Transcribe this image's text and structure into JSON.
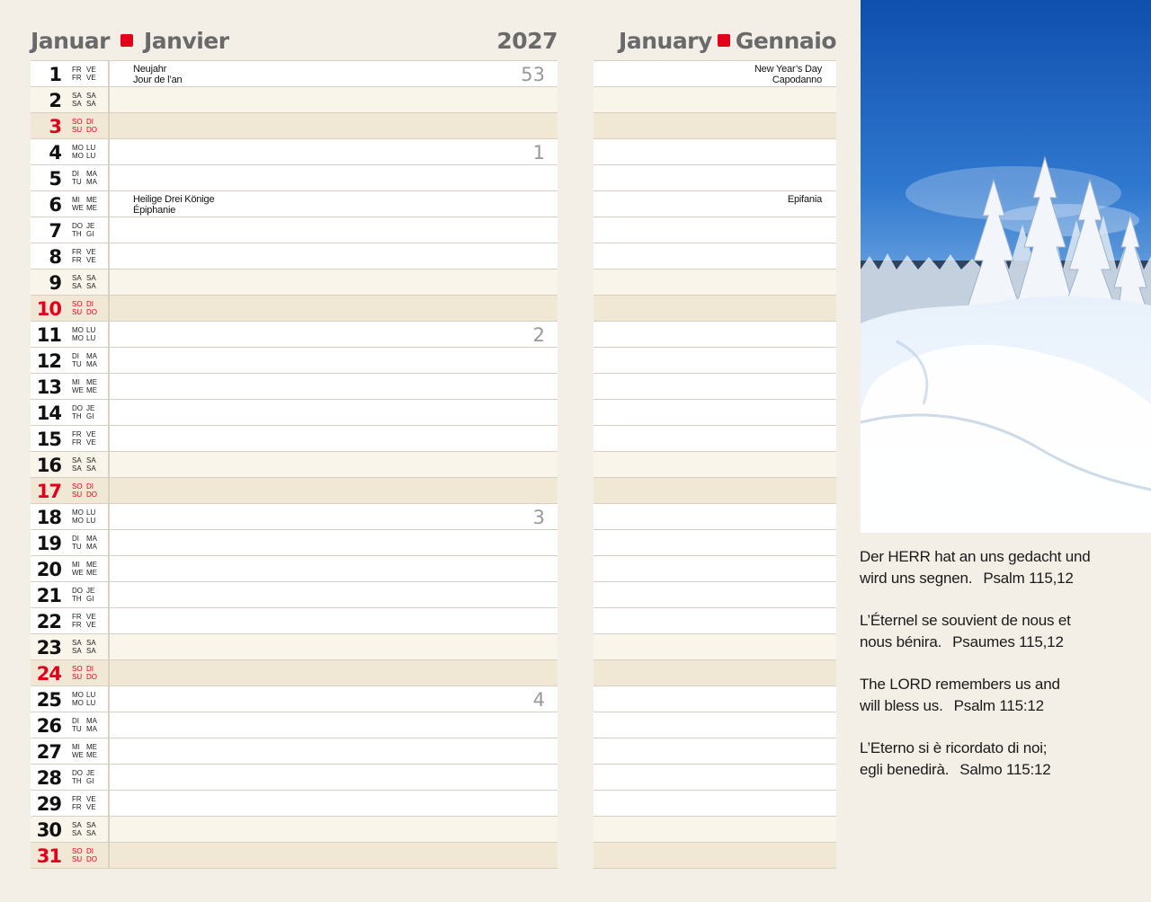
{
  "header": {
    "left_month_de": "Januar",
    "left_month_fr": "Janvier",
    "year": "2027",
    "right_month_en": "January",
    "right_month_it": "Gennaio",
    "accent_color": "#e3001b"
  },
  "days": [
    {
      "day": "1",
      "a1": "FR",
      "a2": "VE",
      "a3": "FR",
      "a4": "VE",
      "type": "weekday",
      "week": "53",
      "note_l1": "Neujahr",
      "note_l2": "Jour de l’an",
      "rnote_l1": "New Year’s Day",
      "rnote_l2": "Capodanno"
    },
    {
      "day": "2",
      "a1": "SA",
      "a2": "SA",
      "a3": "SA",
      "a4": "SA",
      "type": "sat"
    },
    {
      "day": "3",
      "a1": "SO",
      "a2": "DI",
      "a3": "SU",
      "a4": "DO",
      "type": "sun"
    },
    {
      "day": "4",
      "a1": "MO",
      "a2": "LU",
      "a3": "MO",
      "a4": "LU",
      "type": "weekday",
      "week": "1"
    },
    {
      "day": "5",
      "a1": "DI",
      "a2": "MA",
      "a3": "TU",
      "a4": "MA",
      "type": "weekday"
    },
    {
      "day": "6",
      "a1": "MI",
      "a2": "ME",
      "a3": "WE",
      "a4": "ME",
      "type": "weekday",
      "note_l1": "Heilige Drei Könige",
      "note_l2": "Épiphanie",
      "rnote_l1": "",
      "rnote_l2": "Epifania"
    },
    {
      "day": "7",
      "a1": "DO",
      "a2": "JE",
      "a3": "TH",
      "a4": "GI",
      "type": "weekday"
    },
    {
      "day": "8",
      "a1": "FR",
      "a2": "VE",
      "a3": "FR",
      "a4": "VE",
      "type": "weekday"
    },
    {
      "day": "9",
      "a1": "SA",
      "a2": "SA",
      "a3": "SA",
      "a4": "SA",
      "type": "sat"
    },
    {
      "day": "10",
      "a1": "SO",
      "a2": "DI",
      "a3": "SU",
      "a4": "DO",
      "type": "sun"
    },
    {
      "day": "11",
      "a1": "MO",
      "a2": "LU",
      "a3": "MO",
      "a4": "LU",
      "type": "weekday",
      "week": "2"
    },
    {
      "day": "12",
      "a1": "DI",
      "a2": "MA",
      "a3": "TU",
      "a4": "MA",
      "type": "weekday"
    },
    {
      "day": "13",
      "a1": "MI",
      "a2": "ME",
      "a3": "WE",
      "a4": "ME",
      "type": "weekday"
    },
    {
      "day": "14",
      "a1": "DO",
      "a2": "JE",
      "a3": "TH",
      "a4": "GI",
      "type": "weekday"
    },
    {
      "day": "15",
      "a1": "FR",
      "a2": "VE",
      "a3": "FR",
      "a4": "VE",
      "type": "weekday"
    },
    {
      "day": "16",
      "a1": "SA",
      "a2": "SA",
      "a3": "SA",
      "a4": "SA",
      "type": "sat"
    },
    {
      "day": "17",
      "a1": "SO",
      "a2": "DI",
      "a3": "SU",
      "a4": "DO",
      "type": "sun"
    },
    {
      "day": "18",
      "a1": "MO",
      "a2": "LU",
      "a3": "MO",
      "a4": "LU",
      "type": "weekday",
      "week": "3"
    },
    {
      "day": "19",
      "a1": "DI",
      "a2": "MA",
      "a3": "TU",
      "a4": "MA",
      "type": "weekday"
    },
    {
      "day": "20",
      "a1": "MI",
      "a2": "ME",
      "a3": "WE",
      "a4": "ME",
      "type": "weekday"
    },
    {
      "day": "21",
      "a1": "DO",
      "a2": "JE",
      "a3": "TH",
      "a4": "GI",
      "type": "weekday"
    },
    {
      "day": "22",
      "a1": "FR",
      "a2": "VE",
      "a3": "FR",
      "a4": "VE",
      "type": "weekday"
    },
    {
      "day": "23",
      "a1": "SA",
      "a2": "SA",
      "a3": "SA",
      "a4": "SA",
      "type": "sat"
    },
    {
      "day": "24",
      "a1": "SO",
      "a2": "DI",
      "a3": "SU",
      "a4": "DO",
      "type": "sun"
    },
    {
      "day": "25",
      "a1": "MO",
      "a2": "LU",
      "a3": "MO",
      "a4": "LU",
      "type": "weekday",
      "week": "4"
    },
    {
      "day": "26",
      "a1": "DI",
      "a2": "MA",
      "a3": "TU",
      "a4": "MA",
      "type": "weekday"
    },
    {
      "day": "27",
      "a1": "MI",
      "a2": "ME",
      "a3": "WE",
      "a4": "ME",
      "type": "weekday"
    },
    {
      "day": "28",
      "a1": "DO",
      "a2": "JE",
      "a3": "TH",
      "a4": "GI",
      "type": "weekday"
    },
    {
      "day": "29",
      "a1": "FR",
      "a2": "VE",
      "a3": "FR",
      "a4": "VE",
      "type": "weekday"
    },
    {
      "day": "30",
      "a1": "SA",
      "a2": "SA",
      "a3": "SA",
      "a4": "SA",
      "type": "sat"
    },
    {
      "day": "31",
      "a1": "SO",
      "a2": "DI",
      "a3": "SU",
      "a4": "DO",
      "type": "sun"
    }
  ],
  "verses": [
    {
      "line1": "Der HERR hat an uns gedacht und",
      "line2": "wird uns segnen.",
      "ref": "Psalm 115,12"
    },
    {
      "line1": "L’Éternel se souvient de nous et",
      "line2": "nous bénira.",
      "ref": "Psaumes 115,12"
    },
    {
      "line1": "The LORD remembers us and",
      "line2": "will bless us.",
      "ref": "Psalm 115:12"
    },
    {
      "line1": "L’Eterno si è ricordato di noi;",
      "line2": "egli benedirà.",
      "ref": "Salmo 115:12"
    }
  ],
  "photo": {
    "subject": "snow-landscape"
  }
}
